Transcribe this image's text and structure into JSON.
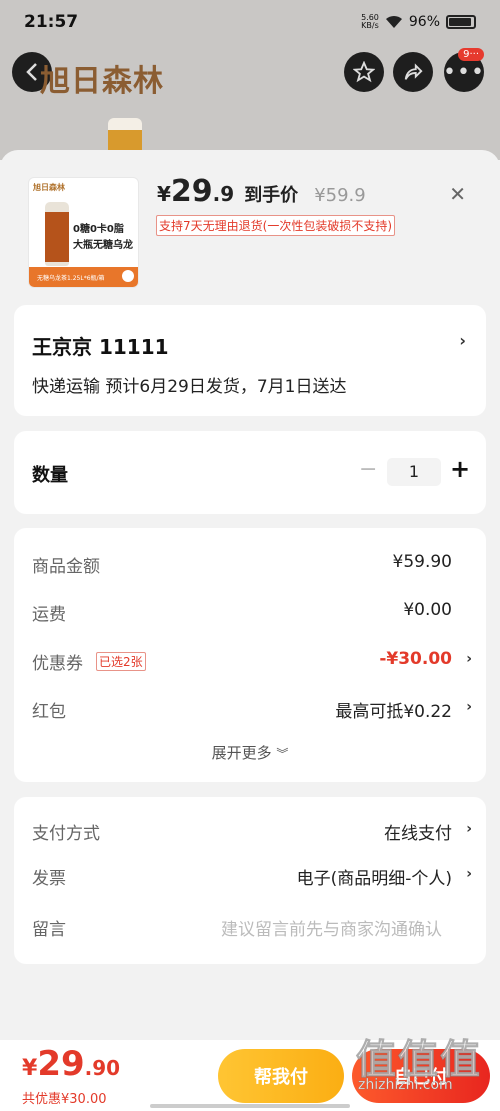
{
  "status_bar": {
    "time": "21:57",
    "net_speed_value": "5.60",
    "net_speed_unit": "KB/s",
    "battery": "96%"
  },
  "background_page": {
    "brand": "旭日森林",
    "notification_count": "9···"
  },
  "product": {
    "thumb_brand": "旭日森林",
    "thumb_line1": "0糖0卡0脂",
    "thumb_line2": "大瓶无糖乌龙",
    "thumb_strip": "无糖乌龙茶1.25L*6瓶/箱",
    "price_symbol": "¥",
    "price_int": "29",
    "price_dec": ".9",
    "price_label": "到手价",
    "original_price": "¥59.9",
    "return_policy": "支持7天无理由退货(一次性包装破损不支持)"
  },
  "address": {
    "name_line": "王京京  11111",
    "delivery": "快递运输 预计6月29日发货，7月1日送达"
  },
  "quantity": {
    "label": "数量",
    "value": "1",
    "minus": "−",
    "plus": "+"
  },
  "fees": {
    "goods_label": "商品金额",
    "goods_value": "¥59.90",
    "shipping_label": "运费",
    "shipping_value": "¥0.00",
    "coupon_label": "优惠券",
    "coupon_tag": "已选2张",
    "coupon_value": "-¥30.00",
    "redpacket_label": "红包",
    "redpacket_value": "最高可抵¥0.22",
    "expand_more": "展开更多"
  },
  "payment": {
    "method_label": "支付方式",
    "method_value": "在线支付",
    "invoice_label": "发票",
    "invoice_value": "电子(商品明细-个人)",
    "message_label": "留言",
    "message_placeholder": "建议留言前先与商家沟通确认"
  },
  "bottom_bar": {
    "total_symbol": "¥",
    "total_int": "29",
    "total_dec": ".90",
    "discount": "共优惠¥30.00",
    "help_pay": "帮我付",
    "self_pay": "自己付"
  },
  "watermark": {
    "glyphs": "值值值",
    "url": "zhizhizhi.com"
  },
  "colors": {
    "accent_red": "#e33a2a",
    "help_pay_yellow": "#fbae13",
    "self_pay_red": "#e8261f"
  }
}
